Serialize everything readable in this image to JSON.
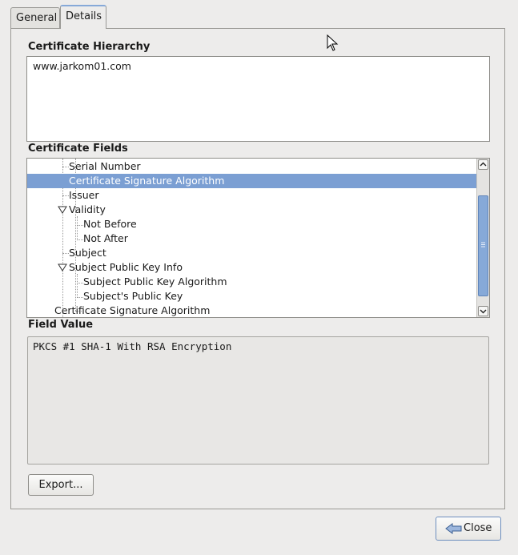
{
  "tabs": {
    "general": "General",
    "details": "Details"
  },
  "hierarchy": {
    "label": "Certificate Hierarchy",
    "items": [
      "www.jarkom01.com"
    ]
  },
  "fields": {
    "label": "Certificate Fields",
    "rows": [
      "Serial Number",
      "Certificate Signature Algorithm",
      "Issuer",
      "Validity",
      "Not Before",
      "Not After",
      "Subject",
      "Subject Public Key Info",
      "Subject Public Key Algorithm",
      "Subject's Public Key",
      "Certificate Signature Algorithm"
    ],
    "selected_index": 1
  },
  "field_value": {
    "label": "Field Value",
    "text": "PKCS #1 SHA-1 With RSA Encryption"
  },
  "buttons": {
    "export": "Export...",
    "close": "Close"
  },
  "colors": {
    "selection": "#7b9fd3",
    "accent": "#86a9d8"
  }
}
